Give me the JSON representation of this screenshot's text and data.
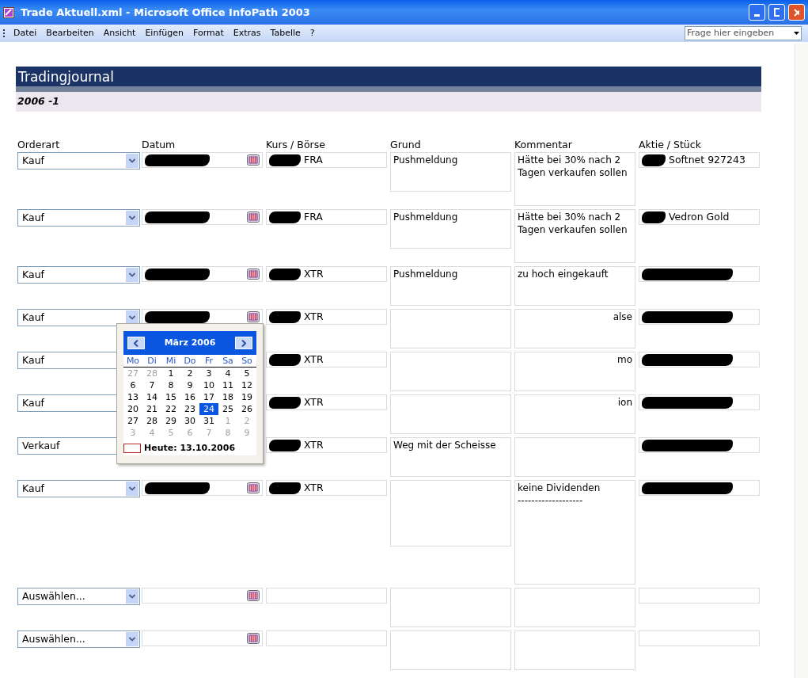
{
  "window": {
    "title": "Trade Aktuell.xml - Microsoft Office InfoPath 2003"
  },
  "menu": [
    "Datei",
    "Bearbeiten",
    "Ansicht",
    "Einfügen",
    "Format",
    "Extras",
    "Tabelle",
    "?"
  ],
  "help_search": {
    "placeholder": "Frage hier eingeben"
  },
  "form": {
    "title": "Tradingjournal",
    "subtitle": "2006 -1",
    "columns": [
      "Orderart",
      "Datum",
      "Kurs / Börse",
      "Grund",
      "Kommentar",
      "Aktie / Stück"
    ],
    "rows": [
      {
        "orderart": "Kauf",
        "datum": {
          "redacted": true
        },
        "kurs": {
          "text": "FRA",
          "redacted": true
        },
        "grund": {
          "text": "Pushmeldung"
        },
        "kommentar": {
          "text": "Hätte bei 30% nach 2 Tagen verkaufen sollen"
        },
        "aktie": {
          "text": "Softnet 927243",
          "redacted": true
        }
      },
      {
        "orderart": "Kauf",
        "datum": {
          "redacted": true
        },
        "kurs": {
          "text": "FRA",
          "redacted": true
        },
        "grund": {
          "text": "Pushmeldung"
        },
        "kommentar": {
          "text": "Hätte bei 30% nach 2 Tagen verkaufen sollen"
        },
        "aktie": {
          "text": "Vedron Gold",
          "redacted": true
        }
      },
      {
        "orderart": "Kauf",
        "datum": {
          "redacted": true
        },
        "kurs": {
          "text": "XTR",
          "redacted": true
        },
        "grund": {
          "text": "Pushmeldung"
        },
        "kommentar": {
          "text": "zu hoch eingekauft"
        },
        "aktie": {
          "redacted": true
        }
      },
      {
        "orderart": "Kauf",
        "datum": {
          "redacted": true
        },
        "kurs": {
          "text": "XTR",
          "redacted": true
        },
        "grund": {},
        "kommentar": {
          "text": "alse",
          "clipped": true
        },
        "aktie": {
          "redacted": true
        }
      },
      {
        "orderart": "Kauf",
        "under_popup": true,
        "datum": {},
        "kurs": {
          "text": "XTR",
          "redacted": true
        },
        "grund": {},
        "kommentar": {
          "text": "mo",
          "clipped": true
        },
        "aktie": {
          "redacted": true
        }
      },
      {
        "orderart": "Kauf",
        "under_popup": true,
        "datum": {},
        "kurs": {
          "text": "XTR",
          "redacted": true
        },
        "grund": {},
        "kommentar": {
          "text": "ion",
          "clipped": true
        },
        "aktie": {
          "redacted": true
        }
      },
      {
        "orderart": "Verkauf",
        "under_popup": true,
        "datum": {},
        "kurs": {
          "text": "XTR",
          "redacted": true
        },
        "grund": {
          "text": "Weg mit der Scheisse"
        },
        "kommentar": {},
        "aktie": {
          "redacted": true
        }
      },
      {
        "orderart": "Kauf",
        "datum": {
          "redacted": true
        },
        "kurs": {
          "text": "XTR",
          "redacted": true
        },
        "grund": {},
        "kommentar": {
          "text": "keine Dividenden\n-------------------"
        },
        "aktie": {
          "redacted": true
        }
      },
      {
        "orderart": "Auswählen...",
        "datum": {},
        "kurs": {},
        "grund": {},
        "kommentar": {},
        "aktie": {}
      },
      {
        "orderart": "Auswählen...",
        "datum": {},
        "kurs": {},
        "grund": {},
        "kommentar": {},
        "aktie": {}
      }
    ]
  },
  "calendar": {
    "month": "März 2006",
    "weekdays": [
      "Mo",
      "Di",
      "Mi",
      "Do",
      "Fr",
      "Sa",
      "So"
    ],
    "days": [
      {
        "label": "27",
        "muted": true,
        "selected": false
      },
      {
        "label": "28",
        "muted": true,
        "selected": false
      },
      {
        "label": "1",
        "muted": false,
        "selected": false
      },
      {
        "label": "2",
        "muted": false,
        "selected": false
      },
      {
        "label": "3",
        "muted": false,
        "selected": false
      },
      {
        "label": "4",
        "muted": false,
        "selected": false
      },
      {
        "label": "5",
        "muted": false,
        "selected": false
      },
      {
        "label": "6",
        "muted": false,
        "selected": false
      },
      {
        "label": "7",
        "muted": false,
        "selected": false
      },
      {
        "label": "8",
        "muted": false,
        "selected": false
      },
      {
        "label": "9",
        "muted": false,
        "selected": false
      },
      {
        "label": "10",
        "muted": false,
        "selected": false
      },
      {
        "label": "11",
        "muted": false,
        "selected": false
      },
      {
        "label": "12",
        "muted": false,
        "selected": false
      },
      {
        "label": "13",
        "muted": false,
        "selected": false
      },
      {
        "label": "14",
        "muted": false,
        "selected": false
      },
      {
        "label": "15",
        "muted": false,
        "selected": false
      },
      {
        "label": "16",
        "muted": false,
        "selected": false
      },
      {
        "label": "17",
        "muted": false,
        "selected": false
      },
      {
        "label": "18",
        "muted": false,
        "selected": false
      },
      {
        "label": "19",
        "muted": false,
        "selected": false
      },
      {
        "label": "20",
        "muted": false,
        "selected": false
      },
      {
        "label": "21",
        "muted": false,
        "selected": false
      },
      {
        "label": "22",
        "muted": false,
        "selected": false
      },
      {
        "label": "23",
        "muted": false,
        "selected": false
      },
      {
        "label": "24",
        "muted": false,
        "selected": true
      },
      {
        "label": "25",
        "muted": false,
        "selected": false
      },
      {
        "label": "26",
        "muted": false,
        "selected": false
      },
      {
        "label": "27",
        "muted": false,
        "selected": false
      },
      {
        "label": "28",
        "muted": false,
        "selected": false
      },
      {
        "label": "29",
        "muted": false,
        "selected": false
      },
      {
        "label": "30",
        "muted": false,
        "selected": false
      },
      {
        "label": "31",
        "muted": false,
        "selected": false
      },
      {
        "label": "1",
        "muted": true,
        "selected": false
      },
      {
        "label": "2",
        "muted": true,
        "selected": false
      },
      {
        "label": "3",
        "muted": true,
        "selected": false
      },
      {
        "label": "4",
        "muted": true,
        "selected": false
      },
      {
        "label": "5",
        "muted": true,
        "selected": false
      },
      {
        "label": "6",
        "muted": true,
        "selected": false
      },
      {
        "label": "7",
        "muted": true,
        "selected": false
      },
      {
        "label": "8",
        "muted": true,
        "selected": false
      },
      {
        "label": "9",
        "muted": true,
        "selected": false
      }
    ],
    "today": "Heute: 13.10.2006"
  }
}
